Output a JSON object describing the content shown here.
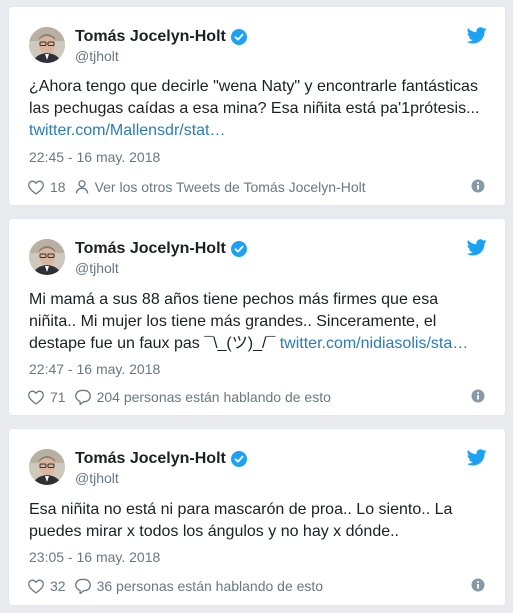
{
  "tweets": [
    {
      "author_name": "Tomás Jocelyn-Holt",
      "handle": "@tjholt",
      "text": "¿Ahora tengo que decirle \"wena Naty\" y encontrarle fantásticas las pechugas caídas a esa mina? Esa niñita está pa'1prótesis...",
      "link": "twitter.com/Mallensdr/stat…",
      "time": "22:45 - 16 may. 2018",
      "likes": "18",
      "secondary_action": "Ver los otros Tweets de Tomás Jocelyn-Holt",
      "secondary_icon": "person-icon"
    },
    {
      "author_name": "Tomás Jocelyn-Holt",
      "handle": "@tjholt",
      "text": "Mi mamá a sus 88 años tiene pechos más firmes que esa niñita.. Mi mujer los tiene más grandes.. Sinceramente, el destape fue un faux pas ¯\\_(ツ)_/¯",
      "link": "twitter.com/nidiasolis/sta…",
      "time": "22:47 - 16 may. 2018",
      "likes": "71",
      "secondary_action": "204 personas están hablando de esto",
      "secondary_icon": "reply-icon"
    },
    {
      "author_name": "Tomás Jocelyn-Holt",
      "handle": "@tjholt",
      "text": "Esa niñita no está ni para mascarón de proa.. Lo siento.. La puedes mirar x todos los ángulos y no hay x dónde..",
      "link": "",
      "time": "23:05 - 16 may. 2018",
      "likes": "32",
      "secondary_action": "36 personas están hablando de esto",
      "secondary_icon": "reply-icon"
    }
  ],
  "colors": {
    "link": "#2b7bb9",
    "twitter_blue": "#1da1f2",
    "muted": "#697882",
    "text": "#1c2022"
  }
}
